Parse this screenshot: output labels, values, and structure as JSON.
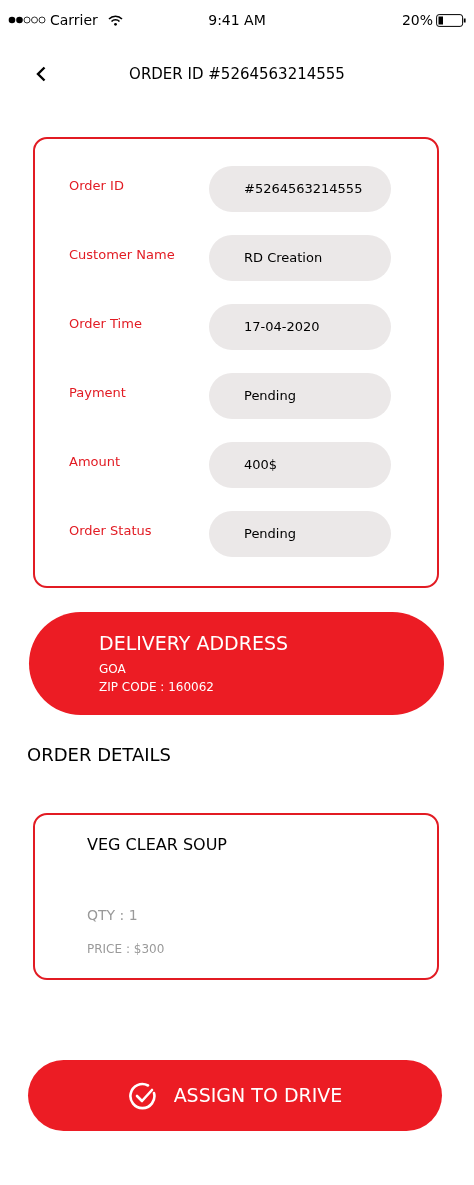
{
  "status_bar": {
    "carrier": "Carrier",
    "time": "9:41 AM",
    "battery": "20%"
  },
  "header": {
    "title": "ORDER ID #5264563214555"
  },
  "order_info": [
    {
      "label": "Order ID",
      "value": "#5264563214555"
    },
    {
      "label": "Customer Name",
      "value": "RD Creation"
    },
    {
      "label": "Order Time",
      "value": "17-04-2020"
    },
    {
      "label": "Payment",
      "value": "Pending"
    },
    {
      "label": "Amount",
      "value": "400$"
    },
    {
      "label": "Order Status",
      "value": "Pending"
    }
  ],
  "delivery_address": {
    "title": "DELIVERY ADDRESS",
    "lines": [
      "GOA",
      "ZIP CODE : 160062"
    ]
  },
  "order_details": {
    "heading": "ORDER DETAILS",
    "items": [
      {
        "name": "VEG CLEAR SOUP",
        "qty": "QTY : 1",
        "price": "PRICE : $300"
      }
    ]
  },
  "action_button": {
    "label": "ASSIGN TO DRIVE"
  }
}
